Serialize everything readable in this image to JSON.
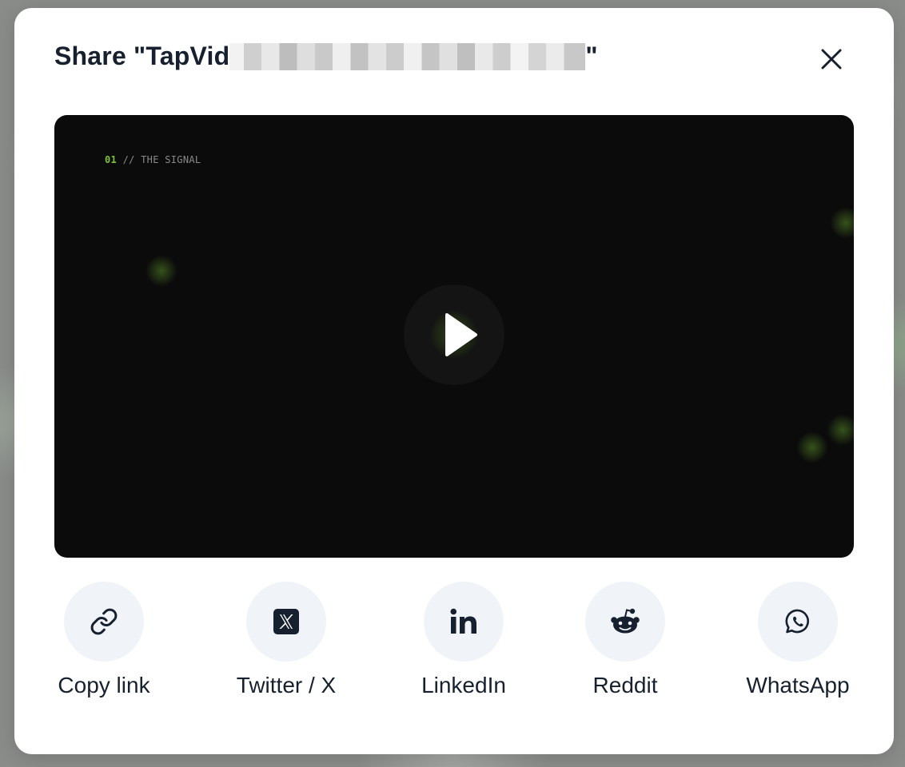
{
  "dialog": {
    "title_prefix": "Share \"TapVid",
    "title_suffix": "\""
  },
  "video": {
    "caption_number": "01",
    "caption_text": " // THE SIGNAL"
  },
  "share_options": [
    {
      "label": "Copy link",
      "icon": "link-icon"
    },
    {
      "label": "Twitter / X",
      "icon": "x-logo-icon"
    },
    {
      "label": "LinkedIn",
      "icon": "linkedin-icon"
    },
    {
      "label": "Reddit",
      "icon": "reddit-icon"
    },
    {
      "label": "WhatsApp",
      "icon": "whatsapp-icon"
    }
  ],
  "colors": {
    "text": "#17202e",
    "share_button_bg": "#f0f3f7",
    "video_bg": "#0b0b0b",
    "caption_accent": "#7ec23a"
  }
}
